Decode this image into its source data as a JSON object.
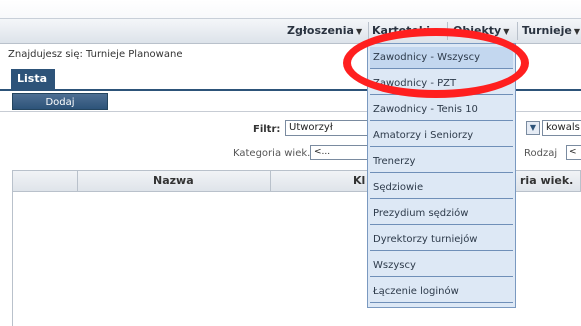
{
  "menu": {
    "items": [
      {
        "label": "Zgłoszenia"
      },
      {
        "label": "Kartoteki"
      },
      {
        "label": "Obiekty"
      },
      {
        "label": "Turnieje"
      }
    ]
  },
  "breadcrumb": "Znajdujesz się: Turnieje Planowane",
  "tabs": [
    {
      "label": "Lista"
    }
  ],
  "actions": {
    "add_label": "Dodaj"
  },
  "filter": {
    "label": "Filtr:",
    "value": "Utworzył",
    "right_value": "kowals"
  },
  "category": {
    "label": "Kategoria wiek.",
    "value": "<..."
  },
  "kind": {
    "label": "Rodzaj",
    "value": "<"
  },
  "grid": {
    "columns": [
      "Nazwa",
      "Kl",
      "ria wiek."
    ]
  },
  "dropdown": {
    "items": [
      {
        "label": "Zawodnicy - Wszyscy"
      },
      {
        "label": "Zawodnicy - PZT"
      },
      {
        "label": "Zawodnicy - Tenis 10"
      },
      {
        "label": "Amatorzy i Seniorzy"
      },
      {
        "label": "Trenerzy"
      },
      {
        "label": "Sędziowie"
      },
      {
        "label": "Prezydium sędziów"
      },
      {
        "label": "Dyrektorzy turniejów"
      },
      {
        "label": "Wszyscy"
      },
      {
        "label": "Łączenie loginów"
      }
    ]
  },
  "colors": {
    "accent": "#2d5379",
    "dropdown_bg": "#dde8f5",
    "highlight_ring": "#ff1f1f"
  }
}
